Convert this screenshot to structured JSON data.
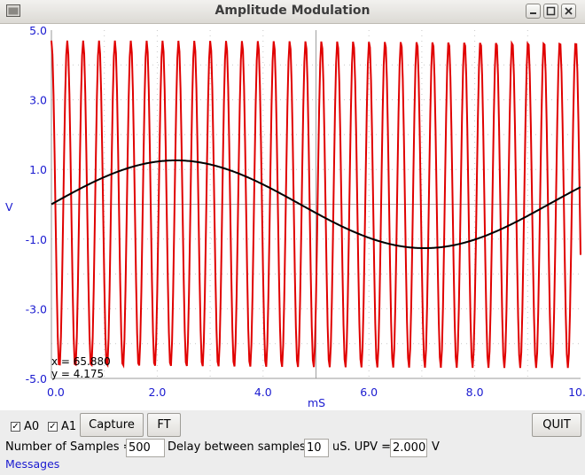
{
  "window": {
    "title": "Amplitude Modulation"
  },
  "chart_data": {
    "type": "line",
    "xlabel": "mS",
    "ylabel": "V",
    "xlim": [
      0,
      10
    ],
    "ylim": [
      -5,
      5
    ],
    "x_ticks": [
      "0.0",
      "2.0",
      "4.0",
      "6.0",
      "8.0",
      "10.0"
    ],
    "y_ticks": [
      "5.0",
      "3.0",
      "1.0",
      "-1.0",
      "-3.0",
      "-5.0"
    ],
    "grid": true,
    "series": [
      {
        "color": "#e00000",
        "description_values": {
          "amplitude": 4.7,
          "offset": 0,
          "frequency_per_ms": 3.33,
          "samples": 500,
          "x_start": 0,
          "x_end": 10
        }
      },
      {
        "color": "#000000",
        "description_values": {
          "amplitude": 1.26,
          "offset": 0,
          "period_ms": 9.4,
          "phase_at_0": 0,
          "samples": 500,
          "x_start": 0,
          "x_end": 10
        }
      }
    ],
    "cursor": {
      "x_readout": "x = 65.880",
      "y_readout": "y = 4.175"
    }
  },
  "controls": {
    "ch0_label": "A0",
    "ch0_checked": true,
    "ch1_label": "A1",
    "ch1_checked": true,
    "capture_label": "Capture",
    "ft_label": "FT",
    "quit_label": "QUIT",
    "samples_label": "Number of Samples =",
    "samples_value": "500",
    "delay_label": "Delay between samples=",
    "delay_value": "10",
    "upv_label": "uS. UPV =",
    "upv_value": "2.000",
    "upv_unit": "V",
    "messages_label": "Messages"
  }
}
